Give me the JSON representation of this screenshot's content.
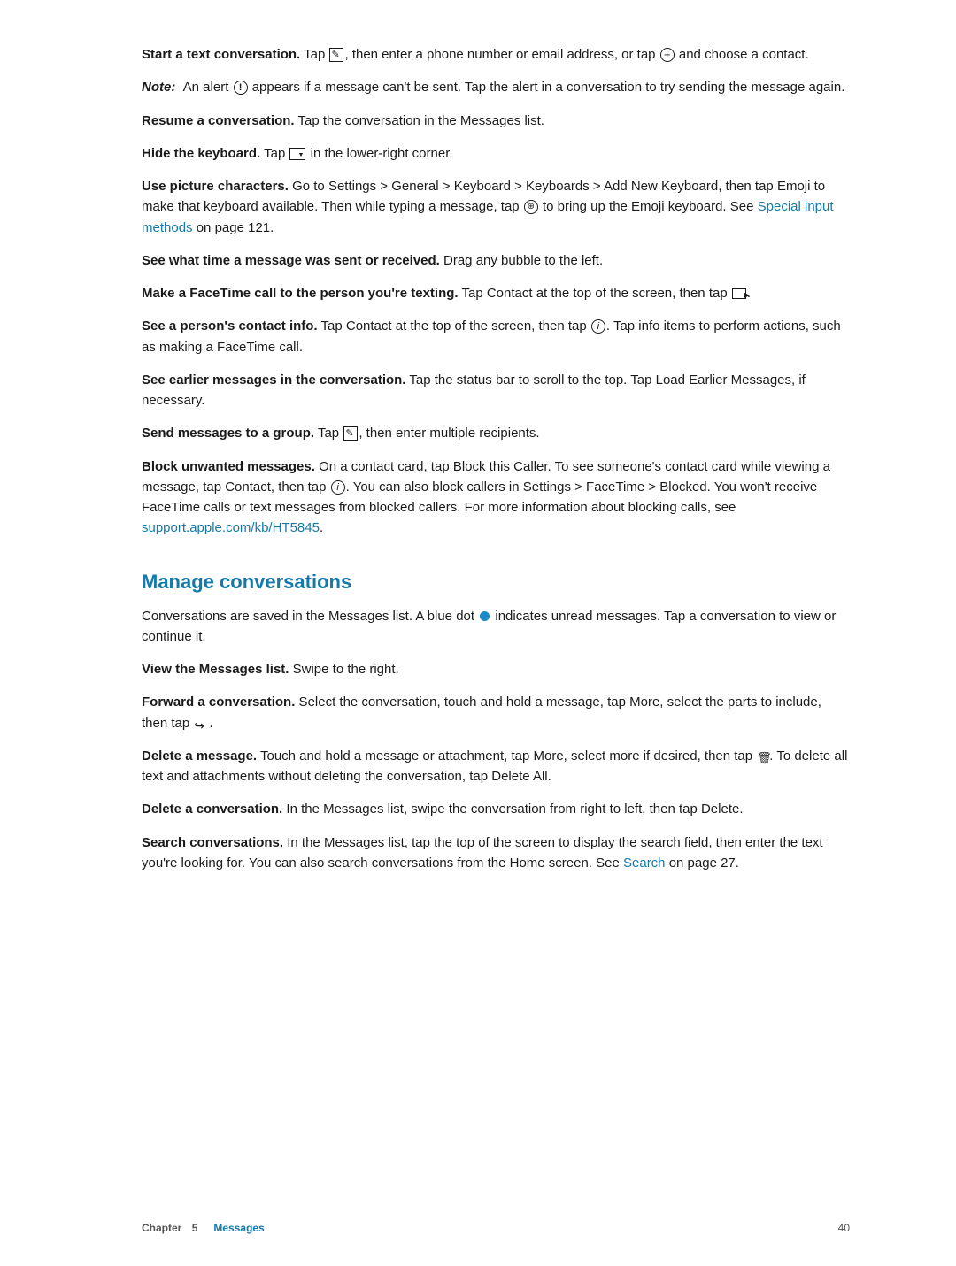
{
  "page": {
    "paragraphs": [
      {
        "id": "start-text-conversation",
        "bold_start": "Start a text conversation.",
        "text": " Tap , then enter a phone number or email address, or tap  and choose a contact."
      },
      {
        "id": "note-alert",
        "italic_bold_start": "Note:",
        "text": "  An alert  appears if a message can't be sent. Tap the alert in a conversation to try sending the message again."
      },
      {
        "id": "resume-conversation",
        "bold_start": "Resume a conversation.",
        "text": " Tap the conversation in the Messages list."
      },
      {
        "id": "hide-keyboard",
        "bold_start": "Hide the keyboard.",
        "text": " Tap  in the lower-right corner."
      },
      {
        "id": "use-picture-characters",
        "bold_start": "Use picture characters.",
        "text": " Go to Settings > General > Keyboard > Keyboards > Add New Keyboard, then tap Emoji to make that keyboard available. Then while typing a message, tap  to bring up the Emoji keyboard. See ",
        "link_text": "Special input methods",
        "link_href": "#special-input-methods",
        "text_after": " on page 121."
      },
      {
        "id": "see-time",
        "bold_start": "See what time a message was sent or received.",
        "text": " Drag any bubble to the left."
      },
      {
        "id": "facetime-call",
        "bold_start": "Make a FaceTime call to the person you're texting.",
        "text": " Tap Contact at the top of the screen, then tap ."
      },
      {
        "id": "contact-info",
        "bold_start": "See a person's contact info.",
        "text": " Tap Contact at the top of the screen, then tap . Tap info items to perform actions, such as making a FaceTime call."
      },
      {
        "id": "earlier-messages",
        "bold_start": "See earlier messages in the conversation.",
        "text": " Tap the status bar to scroll to the top. Tap Load Earlier Messages, if necessary."
      },
      {
        "id": "send-to-group",
        "bold_start": "Send messages to a group.",
        "text": " Tap , then enter multiple recipients."
      },
      {
        "id": "block-unwanted",
        "bold_start": "Block unwanted messages.",
        "text": " On a contact card, tap Block this Caller. To see someone's contact card while viewing a message, tap Contact, then tap . You can also block callers in Settings > FaceTime > Blocked. You won't receive FaceTime calls or text messages from blocked callers. For more information about blocking calls, see ",
        "link_text": "support.apple.com/kb/HT5845",
        "link_href": "http://support.apple.com/kb/HT5845",
        "text_after": "."
      }
    ],
    "section": {
      "heading": "Manage conversations",
      "intro": "Conversations are saved in the Messages list. A blue dot  indicates unread messages. Tap a conversation to view or continue it.",
      "items": [
        {
          "id": "view-messages-list",
          "bold_start": "View the Messages list.",
          "text": " Swipe to the right."
        },
        {
          "id": "forward-conversation",
          "bold_start": "Forward a conversation.",
          "text": " Select the conversation, touch and hold a message, tap More, select the parts to include, then tap ."
        },
        {
          "id": "delete-message",
          "bold_start": "Delete a message.",
          "text": " Touch and hold a message or attachment, tap More, select more if desired, then tap . To delete all text and attachments without deleting the conversation, tap Delete All."
        },
        {
          "id": "delete-conversation",
          "bold_start": "Delete a conversation.",
          "text": " In the Messages list, swipe the conversation from right to left, then tap Delete."
        },
        {
          "id": "search-conversations",
          "bold_start": "Search conversations.",
          "text": " In the Messages list, tap the top of the screen to display the search field, then enter the text you're looking for. You can also search conversations from the Home screen. See ",
          "link_text": "Search",
          "link_href": "#search",
          "text_after": " on page 27."
        }
      ]
    },
    "footer": {
      "chapter_label": "Chapter",
      "chapter_number": "5",
      "chapter_name": "Messages",
      "page_number": "40"
    }
  }
}
